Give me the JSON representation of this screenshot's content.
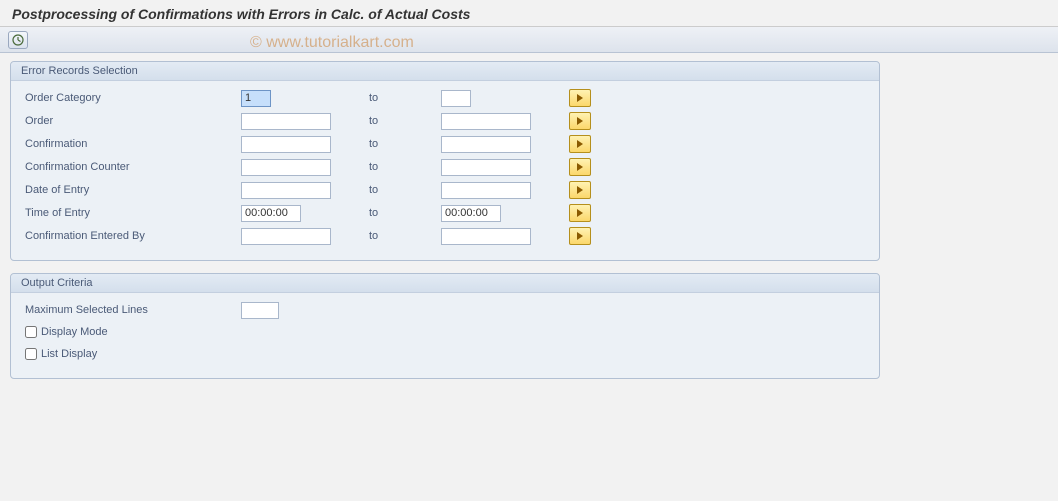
{
  "title": "Postprocessing of Confirmations with Errors in Calc. of Actual Costs",
  "watermark": "© www.tutorialkart.com",
  "group1": {
    "title": "Error Records Selection",
    "to_label": "to",
    "rows": {
      "order_category": {
        "label": "Order Category",
        "from": "1",
        "to": ""
      },
      "order": {
        "label": "Order",
        "from": "",
        "to": ""
      },
      "confirmation": {
        "label": "Confirmation",
        "from": "",
        "to": ""
      },
      "conf_counter": {
        "label": "Confirmation Counter",
        "from": "",
        "to": ""
      },
      "date_of_entry": {
        "label": "Date of Entry",
        "from": "",
        "to": ""
      },
      "time_of_entry": {
        "label": "Time of Entry",
        "from": "00:00:00",
        "to": "00:00:00"
      },
      "entered_by": {
        "label": "Confirmation Entered By",
        "from": "",
        "to": ""
      }
    }
  },
  "group2": {
    "title": "Output Criteria",
    "max_lines": {
      "label": "Maximum Selected Lines",
      "value": ""
    },
    "display_mode": {
      "label": "Display Mode",
      "checked": false
    },
    "list_display": {
      "label": "List Display",
      "checked": false
    }
  }
}
